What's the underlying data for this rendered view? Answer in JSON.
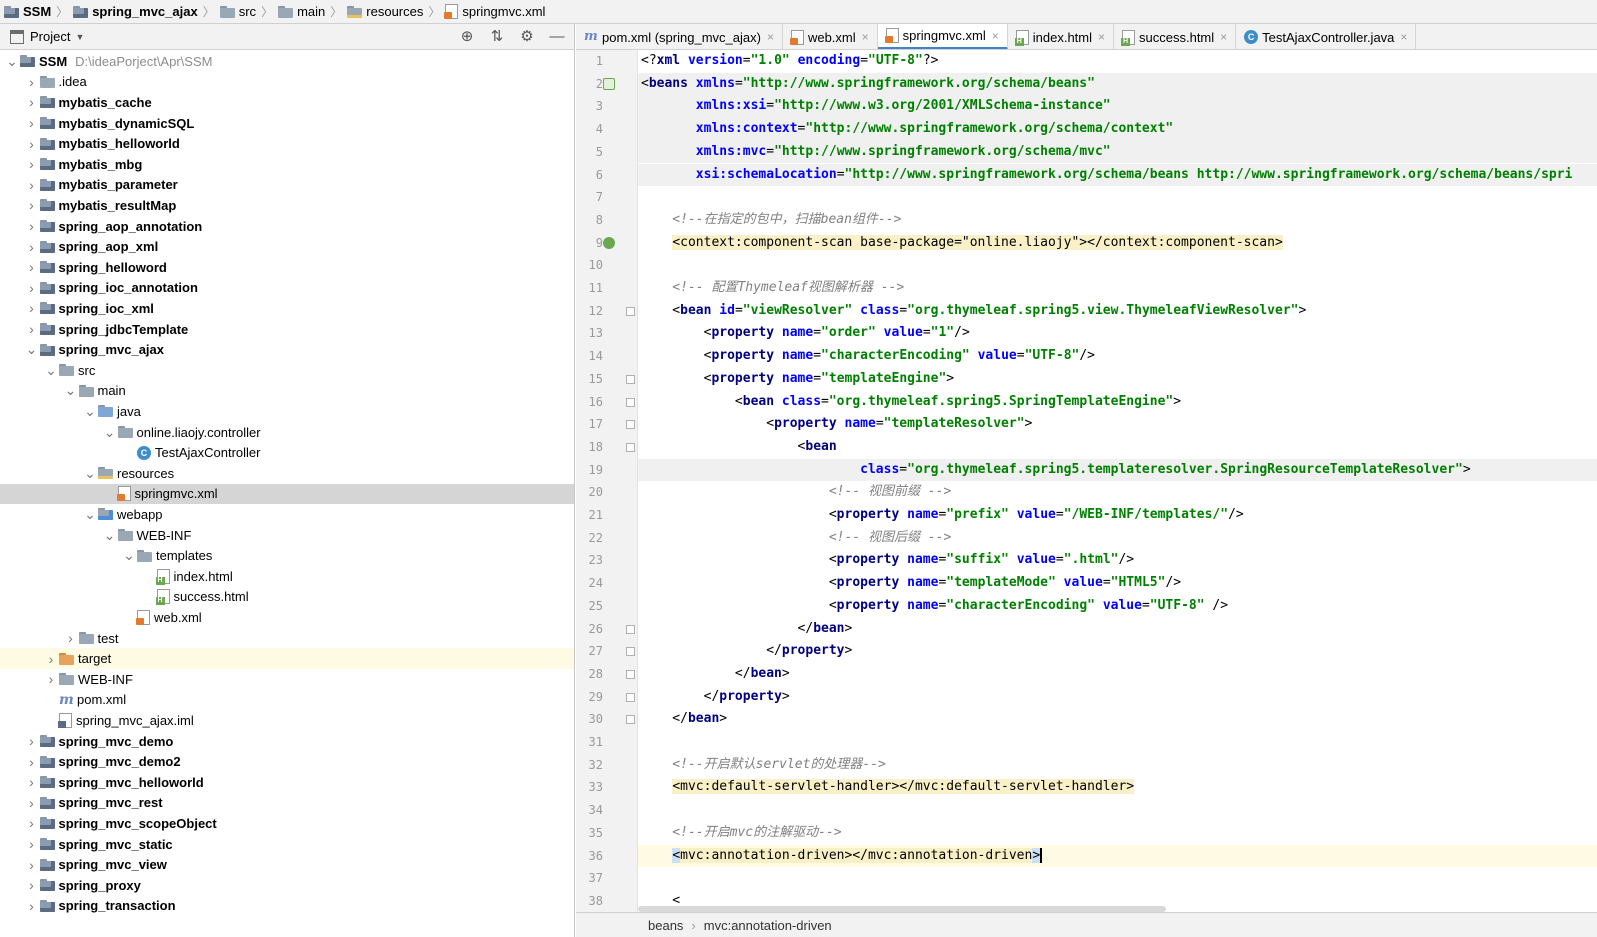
{
  "breadcrumb": [
    "SSM",
    "spring_mvc_ajax",
    "src",
    "main",
    "resources",
    "springmvc.xml"
  ],
  "project_panel": {
    "title": "Project",
    "tree": [
      {
        "label": "SSM",
        "path": "D:\\ideaPorject\\Apr\\SSM",
        "depth": 0,
        "expanded": true,
        "icon": "module-folder",
        "bold": true
      },
      {
        "label": ".idea",
        "depth": 1,
        "expanded": false,
        "icon": "folder"
      },
      {
        "label": "mybatis_cache",
        "depth": 1,
        "expanded": false,
        "icon": "module-folder",
        "bold": true
      },
      {
        "label": "mybatis_dynamicSQL",
        "depth": 1,
        "expanded": false,
        "icon": "module-folder",
        "bold": true
      },
      {
        "label": "mybatis_helloworld",
        "depth": 1,
        "expanded": false,
        "icon": "module-folder",
        "bold": true
      },
      {
        "label": "mybatis_mbg",
        "depth": 1,
        "expanded": false,
        "icon": "module-folder",
        "bold": true
      },
      {
        "label": "mybatis_parameter",
        "depth": 1,
        "expanded": false,
        "icon": "module-folder",
        "bold": true
      },
      {
        "label": "mybatis_resultMap",
        "depth": 1,
        "expanded": false,
        "icon": "module-folder",
        "bold": true
      },
      {
        "label": "spring_aop_annotation",
        "depth": 1,
        "expanded": false,
        "icon": "module-folder",
        "bold": true
      },
      {
        "label": "spring_aop_xml",
        "depth": 1,
        "expanded": false,
        "icon": "module-folder",
        "bold": true
      },
      {
        "label": "spring_helloword",
        "depth": 1,
        "expanded": false,
        "icon": "module-folder",
        "bold": true
      },
      {
        "label": "spring_ioc_annotation",
        "depth": 1,
        "expanded": false,
        "icon": "module-folder",
        "bold": true
      },
      {
        "label": "spring_ioc_xml",
        "depth": 1,
        "expanded": false,
        "icon": "module-folder",
        "bold": true
      },
      {
        "label": "spring_jdbcTemplate",
        "depth": 1,
        "expanded": false,
        "icon": "module-folder",
        "bold": true
      },
      {
        "label": "spring_mvc_ajax",
        "depth": 1,
        "expanded": true,
        "icon": "module-folder",
        "bold": true
      },
      {
        "label": "src",
        "depth": 2,
        "expanded": true,
        "icon": "folder"
      },
      {
        "label": "main",
        "depth": 3,
        "expanded": true,
        "icon": "folder"
      },
      {
        "label": "java",
        "depth": 4,
        "expanded": true,
        "icon": "source-folder"
      },
      {
        "label": "online.liaojy.controller",
        "depth": 5,
        "expanded": true,
        "icon": "package"
      },
      {
        "label": "TestAjaxController",
        "depth": 6,
        "icon": "class"
      },
      {
        "label": "resources",
        "depth": 4,
        "expanded": true,
        "icon": "resources-folder"
      },
      {
        "label": "springmvc.xml",
        "depth": 5,
        "icon": "xml",
        "selected": true
      },
      {
        "label": "webapp",
        "depth": 4,
        "expanded": true,
        "icon": "web-folder"
      },
      {
        "label": "WEB-INF",
        "depth": 5,
        "expanded": true,
        "icon": "folder"
      },
      {
        "label": "templates",
        "depth": 6,
        "expanded": true,
        "icon": "folder"
      },
      {
        "label": "index.html",
        "depth": 7,
        "icon": "html"
      },
      {
        "label": "success.html",
        "depth": 7,
        "icon": "html"
      },
      {
        "label": "web.xml",
        "depth": 6,
        "icon": "xml"
      },
      {
        "label": "test",
        "depth": 3,
        "expanded": false,
        "icon": "folder"
      },
      {
        "label": "target",
        "depth": 2,
        "expanded": false,
        "icon": "orange-folder",
        "highlight": true
      },
      {
        "label": "WEB-INF",
        "depth": 2,
        "expanded": false,
        "icon": "folder"
      },
      {
        "label": "pom.xml",
        "depth": 2,
        "icon": "maven"
      },
      {
        "label": "spring_mvc_ajax.iml",
        "depth": 2,
        "icon": "iml"
      },
      {
        "label": "spring_mvc_demo",
        "depth": 1,
        "expanded": false,
        "icon": "module-folder",
        "bold": true
      },
      {
        "label": "spring_mvc_demo2",
        "depth": 1,
        "expanded": false,
        "icon": "module-folder",
        "bold": true
      },
      {
        "label": "spring_mvc_helloworld",
        "depth": 1,
        "expanded": false,
        "icon": "module-folder",
        "bold": true
      },
      {
        "label": "spring_mvc_rest",
        "depth": 1,
        "expanded": false,
        "icon": "module-folder",
        "bold": true
      },
      {
        "label": "spring_mvc_scopeObject",
        "depth": 1,
        "expanded": false,
        "icon": "module-folder",
        "bold": true
      },
      {
        "label": "spring_mvc_static",
        "depth": 1,
        "expanded": false,
        "icon": "module-folder",
        "bold": true
      },
      {
        "label": "spring_mvc_view",
        "depth": 1,
        "expanded": false,
        "icon": "module-folder",
        "bold": true
      },
      {
        "label": "spring_proxy",
        "depth": 1,
        "expanded": false,
        "icon": "module-folder",
        "bold": true
      },
      {
        "label": "spring_transaction",
        "depth": 1,
        "expanded": false,
        "icon": "module-folder",
        "bold": true
      }
    ]
  },
  "editor_tabs": [
    {
      "label": "pom.xml (spring_mvc_ajax)",
      "icon": "maven"
    },
    {
      "label": "web.xml",
      "icon": "xml"
    },
    {
      "label": "springmvc.xml",
      "icon": "xml",
      "active": true
    },
    {
      "label": "index.html",
      "icon": "html"
    },
    {
      "label": "success.html",
      "icon": "html"
    },
    {
      "label": "TestAjaxController.java",
      "icon": "class"
    }
  ],
  "code_lines": [
    [
      [
        "p",
        "<?"
      ],
      [
        "t",
        "xml "
      ],
      [
        "a",
        "version"
      ],
      [
        "p",
        "="
      ],
      [
        "v",
        "\"1.0\" "
      ],
      [
        "a",
        "encoding"
      ],
      [
        "p",
        "="
      ],
      [
        "v",
        "\"UTF-8\""
      ],
      [
        "p",
        "?>"
      ]
    ],
    [
      [
        "p",
        "<"
      ],
      [
        "t",
        "beans "
      ],
      [
        "a",
        "xmlns"
      ],
      [
        "p",
        "="
      ],
      [
        "v",
        "\"http://www.springframework.org/schema/beans\""
      ]
    ],
    [
      [
        "p",
        "       "
      ],
      [
        "a",
        "xmlns:xsi"
      ],
      [
        "p",
        "="
      ],
      [
        "v",
        "\"http://www.w3.org/2001/XMLSchema-instance\""
      ]
    ],
    [
      [
        "p",
        "       "
      ],
      [
        "a",
        "xmlns:context"
      ],
      [
        "p",
        "="
      ],
      [
        "v",
        "\"http://www.springframework.org/schema/context\""
      ]
    ],
    [
      [
        "p",
        "       "
      ],
      [
        "a",
        "xmlns:mvc"
      ],
      [
        "p",
        "="
      ],
      [
        "v",
        "\"http://www.springframework.org/schema/mvc\""
      ]
    ],
    [
      [
        "p",
        "       "
      ],
      [
        "a",
        "xsi:schemaLocation"
      ],
      [
        "p",
        "="
      ],
      [
        "v",
        "\"http://www.springframework.org/schema/beans http://www.springframework.org/schema/beans/spri"
      ]
    ],
    [],
    [
      [
        "c",
        "    <!--在指定的包中，扫描bean组件-->"
      ]
    ],
    [
      [
        "p",
        "    "
      ],
      [
        "hl",
        "<context:component-scan base-package=\"online.liaojy\"></context:component-scan>"
      ]
    ],
    [],
    [
      [
        "c",
        "    <!-- 配置Thymeleaf视图解析器 -->"
      ]
    ],
    [
      [
        "p",
        "    <"
      ],
      [
        "t",
        "bean "
      ],
      [
        "a",
        "id"
      ],
      [
        "p",
        "="
      ],
      [
        "v",
        "\"viewResolver\" "
      ],
      [
        "a",
        "class"
      ],
      [
        "p",
        "="
      ],
      [
        "v",
        "\"org.thymeleaf.spring5.view.ThymeleafViewResolver\""
      ],
      [
        "p",
        ">"
      ]
    ],
    [
      [
        "p",
        "        <"
      ],
      [
        "t",
        "property "
      ],
      [
        "a",
        "name"
      ],
      [
        "p",
        "="
      ],
      [
        "v",
        "\"order\" "
      ],
      [
        "a",
        "value"
      ],
      [
        "p",
        "="
      ],
      [
        "v",
        "\"1\""
      ],
      [
        "p",
        "/>"
      ]
    ],
    [
      [
        "p",
        "        <"
      ],
      [
        "t",
        "property "
      ],
      [
        "a",
        "name"
      ],
      [
        "p",
        "="
      ],
      [
        "v",
        "\"characterEncoding\" "
      ],
      [
        "a",
        "value"
      ],
      [
        "p",
        "="
      ],
      [
        "v",
        "\"UTF-8\""
      ],
      [
        "p",
        "/>"
      ]
    ],
    [
      [
        "p",
        "        <"
      ],
      [
        "t",
        "property "
      ],
      [
        "a",
        "name"
      ],
      [
        "p",
        "="
      ],
      [
        "v",
        "\"templateEngine\""
      ],
      [
        "p",
        ">"
      ]
    ],
    [
      [
        "p",
        "            <"
      ],
      [
        "t",
        "bean "
      ],
      [
        "a",
        "class"
      ],
      [
        "p",
        "="
      ],
      [
        "v",
        "\"org.thymeleaf.spring5.SpringTemplateEngine\""
      ],
      [
        "p",
        ">"
      ]
    ],
    [
      [
        "p",
        "                <"
      ],
      [
        "t",
        "property "
      ],
      [
        "a",
        "name"
      ],
      [
        "p",
        "="
      ],
      [
        "v",
        "\"templateResolver\""
      ],
      [
        "p",
        ">"
      ]
    ],
    [
      [
        "p",
        "                    <"
      ],
      [
        "t",
        "bean"
      ]
    ],
    [
      [
        "p",
        "                            "
      ],
      [
        "a",
        "class"
      ],
      [
        "p",
        "="
      ],
      [
        "v",
        "\"org.thymeleaf.spring5.templateresolver.SpringResourceTemplateResolver\""
      ],
      [
        "p",
        ">"
      ]
    ],
    [
      [
        "c",
        "                        <!-- 视图前缀 -->"
      ]
    ],
    [
      [
        "p",
        "                        <"
      ],
      [
        "t",
        "property "
      ],
      [
        "a",
        "name"
      ],
      [
        "p",
        "="
      ],
      [
        "v",
        "\"prefix\" "
      ],
      [
        "a",
        "value"
      ],
      [
        "p",
        "="
      ],
      [
        "v",
        "\"/WEB-INF/templates/\""
      ],
      [
        "p",
        "/>"
      ]
    ],
    [
      [
        "c",
        "                        <!-- 视图后缀 -->"
      ]
    ],
    [
      [
        "p",
        "                        <"
      ],
      [
        "t",
        "property "
      ],
      [
        "a",
        "name"
      ],
      [
        "p",
        "="
      ],
      [
        "v",
        "\"suffix\" "
      ],
      [
        "a",
        "value"
      ],
      [
        "p",
        "="
      ],
      [
        "v",
        "\".html\""
      ],
      [
        "p",
        "/>"
      ]
    ],
    [
      [
        "p",
        "                        <"
      ],
      [
        "t",
        "property "
      ],
      [
        "a",
        "name"
      ],
      [
        "p",
        "="
      ],
      [
        "v",
        "\"templateMode\" "
      ],
      [
        "a",
        "value"
      ],
      [
        "p",
        "="
      ],
      [
        "v",
        "\"HTML5\""
      ],
      [
        "p",
        "/>"
      ]
    ],
    [
      [
        "p",
        "                        <"
      ],
      [
        "t",
        "property "
      ],
      [
        "a",
        "name"
      ],
      [
        "p",
        "="
      ],
      [
        "v",
        "\"characterEncoding\" "
      ],
      [
        "a",
        "value"
      ],
      [
        "p",
        "="
      ],
      [
        "v",
        "\"UTF-8\" "
      ],
      [
        "p",
        "/>"
      ]
    ],
    [
      [
        "p",
        "                    </"
      ],
      [
        "t",
        "bean"
      ],
      [
        "p",
        ">"
      ]
    ],
    [
      [
        "p",
        "                </"
      ],
      [
        "t",
        "property"
      ],
      [
        "p",
        ">"
      ]
    ],
    [
      [
        "p",
        "            </"
      ],
      [
        "t",
        "bean"
      ],
      [
        "p",
        ">"
      ]
    ],
    [
      [
        "p",
        "        </"
      ],
      [
        "t",
        "property"
      ],
      [
        "p",
        ">"
      ]
    ],
    [
      [
        "p",
        "    </"
      ],
      [
        "t",
        "bean"
      ],
      [
        "p",
        ">"
      ]
    ],
    [],
    [
      [
        "c",
        "    <!--开启默认servlet的处理器-->"
      ]
    ],
    [
      [
        "p",
        "    "
      ],
      [
        "hl",
        "<mvc:default-servlet-handler></mvc:default-servlet-handler>"
      ]
    ],
    [],
    [
      [
        "c",
        "    <!--开启mvc的注解驱动-->"
      ]
    ],
    [
      [
        "p",
        "    "
      ],
      [
        "hlcur",
        "<"
      ],
      [
        "hl",
        "mvc:annotation-driven></mvc:annotation-driven"
      ],
      [
        "hlcur",
        ">"
      ]
    ],
    [],
    [
      [
        "p",
        "    <"
      ]
    ]
  ],
  "line_numbers": [
    "1",
    "2",
    "3",
    "4",
    "5",
    "6",
    "7",
    "8",
    "9",
    "10",
    "11",
    "12",
    "13",
    "14",
    "15",
    "16",
    "17",
    "18",
    "19",
    "20",
    "21",
    "22",
    "23",
    "24",
    "25",
    "26",
    "27",
    "28",
    "29",
    "30",
    "31",
    "32",
    "33",
    "34",
    "35",
    "36",
    "37",
    "38"
  ],
  "status_path": [
    "beans",
    "mvc:annotation-driven"
  ]
}
